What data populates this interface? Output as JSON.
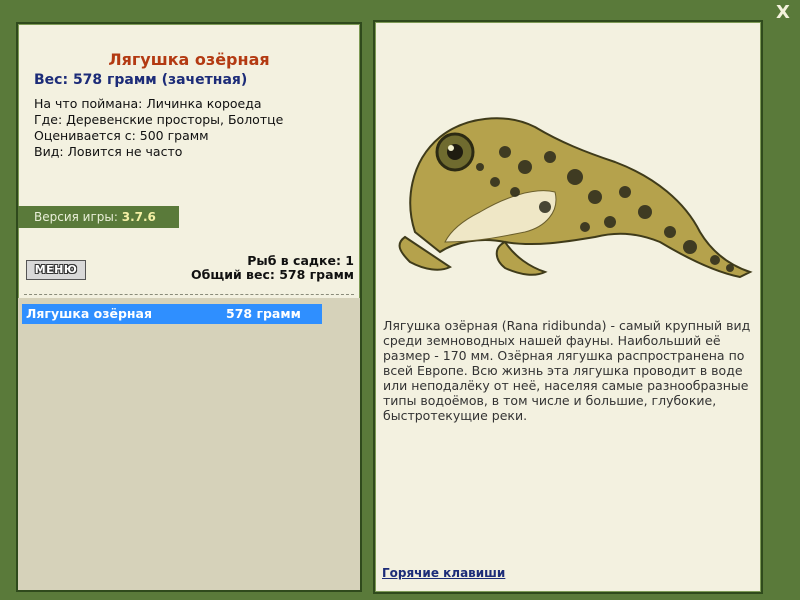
{
  "close": {
    "label": "X"
  },
  "catch_info": {
    "title": "Лягушка озёрная",
    "weight": "Вес: 578 грамм (зачетная)",
    "lines": [
      "На что поймана: Личинка короеда",
      "Где: Деревенские просторы, Болотце",
      "Оценивается с: 500 грамм",
      "Вид: Ловится не часто"
    ]
  },
  "version": {
    "label": "Версия игры: ",
    "value": "3.7.6"
  },
  "menu_button": {
    "label": "МЕНЮ"
  },
  "stats": {
    "fish_in_keepnet": "Рыб в садке: 1",
    "total_weight": "Общий вес: 578 грамм"
  },
  "keepnet": {
    "rows": [
      {
        "name": "Лягушка озёрная",
        "weight": "578 грамм"
      }
    ]
  },
  "description": "Лягушка озёрная (Rana ridibunda) - самый крупный вид среди земноводных нашей фауны. Наибольший её размер - 170 мм. Озёрная лягушка распространена по всей Европе. Всю жизнь эта лягушка проводит в воде или неподалёку от неё, населяя самые разнообразные типы водоёмов, в том числе и большие, глубокие, быстротекущие реки.",
  "links": {
    "hotkeys": "Горячие клавиши"
  },
  "colors": {
    "background": "#5a7a3a",
    "panel": "#f3f1e0",
    "title": "#b33a12",
    "weight": "#1c2c78",
    "selection": "#2f8fff"
  }
}
